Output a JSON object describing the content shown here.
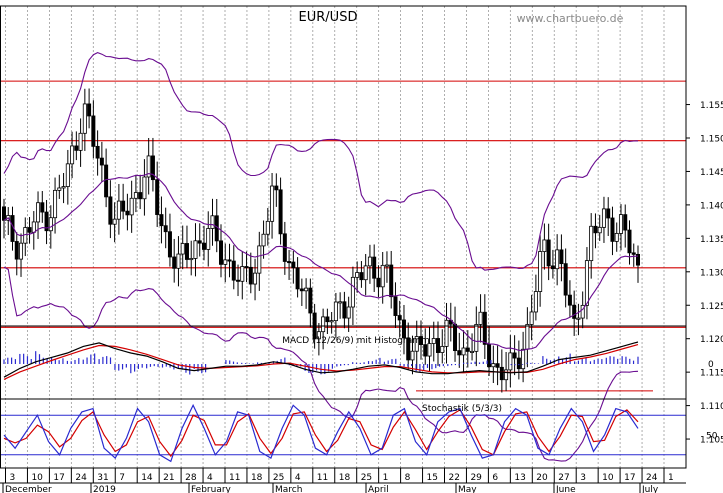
{
  "colors": {
    "background": "#ffffff",
    "frame": "#000000",
    "grid": "#9a9a9a",
    "candle": "#000000",
    "bollinger": "#6a0d91",
    "resistance": "#d40000",
    "macd_line": "#000000",
    "signal_line": "#d40000",
    "histogram": "#2a2ad0",
    "stoch_k": "#2a2ad0",
    "stoch_d": "#d40000",
    "stoch_band": "#2a2ad0",
    "watermark": "#8a8a8a"
  },
  "chart_data": [
    {
      "type": "candlestick",
      "title": "EUR/USD",
      "watermark": "www.chartbuero.de",
      "ylim": [
        1.1,
        1.16
      ],
      "y_ticks": [
        "1.155",
        "1.150",
        "1.145",
        "1.140",
        "1.135",
        "1.130",
        "1.125",
        "1.120",
        "1.115",
        "1.110",
        "1.105"
      ],
      "x_ticks": [
        "3",
        "10",
        "17",
        "24",
        "31",
        "7",
        "14",
        "21",
        "28",
        "4",
        "11",
        "18",
        "25",
        "4",
        "11",
        "18",
        "25",
        "1",
        "8",
        "15",
        "22",
        "29",
        "6",
        "13",
        "20",
        "27",
        "3",
        "10",
        "17",
        "24",
        "1"
      ],
      "x_months": [
        "December",
        "2019",
        "February",
        "March",
        "April",
        "May",
        "June",
        "July"
      ],
      "overlays": [
        "Bollinger Bands"
      ],
      "horizontal_lines": [
        1.1585,
        1.1496,
        1.1306,
        1.1217,
        1.1122
      ],
      "close_weekly": [
        1.1365,
        1.1342,
        1.1378,
        1.1395,
        1.1445,
        1.1548,
        1.146,
        1.1375,
        1.1398,
        1.146,
        1.1365,
        1.1308,
        1.134,
        1.136,
        1.132,
        1.128,
        1.132,
        1.142,
        1.131,
        1.1255,
        1.1212,
        1.124,
        1.1275,
        1.131,
        1.13,
        1.1215,
        1.1175,
        1.1195,
        1.1205,
        1.118,
        1.1215,
        1.1155,
        1.115,
        1.121,
        1.133,
        1.1325,
        1.1205,
        1.135,
        1.138,
        1.1365,
        1.13
      ]
    },
    {
      "type": "line",
      "title": "MACD (12/26/9) mit Histogramm",
      "series": [
        {
          "name": "MACD",
          "values": [
            -0.003,
            -0.001,
            0.0005,
            0.0015,
            0.0025,
            0.004,
            0.0048,
            0.0035,
            0.0025,
            0.0018,
            0.0005,
            -0.001,
            -0.0015,
            -0.001,
            -0.0005,
            -0.0005,
            -0.0002,
            0.0005,
            0.0,
            -0.0012,
            -0.002,
            -0.0018,
            -0.0012,
            -0.0005,
            -0.0002,
            -0.0008,
            -0.0018,
            -0.0022,
            -0.0022,
            -0.0018,
            -0.0015,
            -0.0018,
            -0.002,
            -0.0018,
            -0.0005,
            0.001,
            0.0015,
            0.002,
            0.003,
            0.004,
            0.005
          ]
        },
        {
          "name": "Signal",
          "values": [
            -0.0035,
            -0.0018,
            -0.0005,
            0.0008,
            0.002,
            0.0032,
            0.0042,
            0.004,
            0.0032,
            0.0022,
            0.001,
            -0.0002,
            -0.0008,
            -0.001,
            -0.0008,
            -0.0006,
            -0.0004,
            0.0,
            0.0002,
            -0.0005,
            -0.0012,
            -0.0016,
            -0.0014,
            -0.001,
            -0.0006,
            -0.0006,
            -0.0012,
            -0.0018,
            -0.002,
            -0.002,
            -0.0018,
            -0.0018,
            -0.0019,
            -0.0019,
            -0.0012,
            0.0,
            0.001,
            0.0016,
            0.0024,
            0.0034,
            0.0044
          ]
        }
      ]
    },
    {
      "type": "line",
      "title": "Stochastik (5/3/3)",
      "ylim": [
        0,
        100
      ],
      "y_ticks": [
        "50"
      ],
      "bands": [
        80,
        20
      ],
      "series": [
        {
          "name": "%K",
          "values": [
            50,
            30,
            55,
            80,
            40,
            20,
            60,
            85,
            90,
            30,
            15,
            45,
            90,
            70,
            20,
            10,
            60,
            95,
            60,
            20,
            40,
            85,
            80,
            25,
            15,
            60,
            95,
            80,
            30,
            20,
            55,
            85,
            60,
            20,
            30,
            80,
            90,
            40,
            20,
            70,
            85,
            90,
            50,
            15,
            20,
            70,
            90,
            80,
            30,
            20,
            60,
            90,
            70,
            25,
            50,
            90,
            85,
            60
          ]
        },
        {
          "name": "%D",
          "values": [
            45,
            38,
            45,
            65,
            55,
            32,
            45,
            72,
            85,
            50,
            25,
            35,
            70,
            78,
            40,
            18,
            42,
            80,
            72,
            35,
            35,
            70,
            82,
            45,
            22,
            45,
            82,
            85,
            50,
            25,
            42,
            75,
            70,
            35,
            28,
            62,
            85,
            58,
            28,
            55,
            78,
            88,
            62,
            28,
            20,
            55,
            82,
            85,
            48,
            25,
            48,
            80,
            78,
            40,
            42,
            78,
            88,
            70
          ]
        }
      ]
    }
  ]
}
